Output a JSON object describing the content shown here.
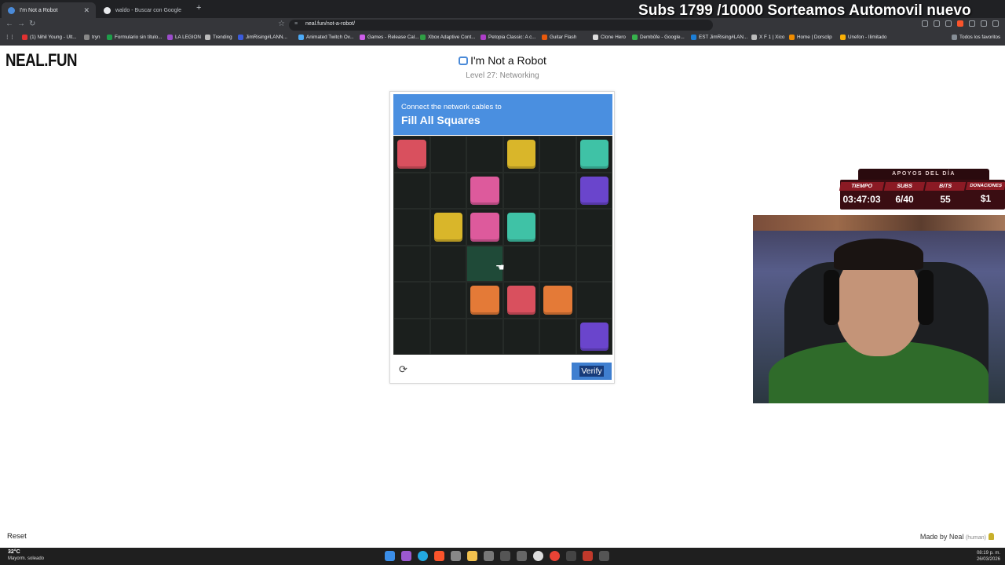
{
  "browser": {
    "tabs": [
      {
        "label": "I'm Not a Robot",
        "active": true
      },
      {
        "label": "waldo - Buscar con Google",
        "active": false
      }
    ],
    "url": "neal.fun/not-a-robot/",
    "bookmarks": [
      "(1) Nihil Young - Ult...",
      "tryn",
      "Formulario sin título...",
      "LA LEGION",
      "Trending",
      "JimRising#LANN...",
      "Animated Twitch Ov...",
      "Games - Release Cal...",
      "Xbox Adaptive Cont...",
      "Petopia Classic: A c...",
      "Guitar Flash",
      "Clone Hero",
      "Dembōfe - Google...",
      "EST JimRising#LAN...",
      "X F 1 | Xico",
      "Home | Dorsclip",
      "Unefon - Ilimitado",
      "Todos los favoritos"
    ]
  },
  "stream_banner": "Subs 1799 /10000 Sorteamos Automovil nuevo",
  "page": {
    "brand": "NEAL.FUN",
    "title": "I'm Not a Robot",
    "level": "Level 27: Networking",
    "reset": "Reset",
    "credit_prefix": "Made by Neal",
    "credit_suffix": "(human)"
  },
  "captcha": {
    "subtitle": "Connect the network cables to",
    "heading": "Fill All Squares",
    "verify_label": "Verify",
    "grid": {
      "rows": 6,
      "cols": 6,
      "highlight": [
        3,
        2
      ],
      "squares": [
        {
          "row": 0,
          "col": 0,
          "color": "#d9505e"
        },
        {
          "row": 0,
          "col": 3,
          "color": "#d9b62a"
        },
        {
          "row": 0,
          "col": 5,
          "color": "#3fc2a6"
        },
        {
          "row": 1,
          "col": 2,
          "color": "#dd5a9c"
        },
        {
          "row": 1,
          "col": 5,
          "color": "#6a45cc"
        },
        {
          "row": 2,
          "col": 1,
          "color": "#d9b62a"
        },
        {
          "row": 2,
          "col": 2,
          "color": "#dd5a9c"
        },
        {
          "row": 2,
          "col": 3,
          "color": "#3fc2a6"
        },
        {
          "row": 4,
          "col": 2,
          "color": "#e47a37"
        },
        {
          "row": 4,
          "col": 3,
          "color": "#d9505e"
        },
        {
          "row": 4,
          "col": 4,
          "color": "#e47a37"
        },
        {
          "row": 5,
          "col": 5,
          "color": "#6a45cc"
        }
      ]
    }
  },
  "stream_stats": {
    "header": "APOYOS DEL DÍA",
    "columns": [
      {
        "label": "TIEMPO",
        "value": "03:47:03"
      },
      {
        "label": "SUBS",
        "value": "6/40"
      },
      {
        "label": "BITS",
        "value": "55"
      },
      {
        "label": "DONACIONES",
        "value": "$1"
      }
    ]
  },
  "taskbar": {
    "weather_temp": "32°C",
    "weather_desc": "Mayorm. soleado",
    "time": "08:19 p. m.",
    "date": "26/03/2026"
  }
}
